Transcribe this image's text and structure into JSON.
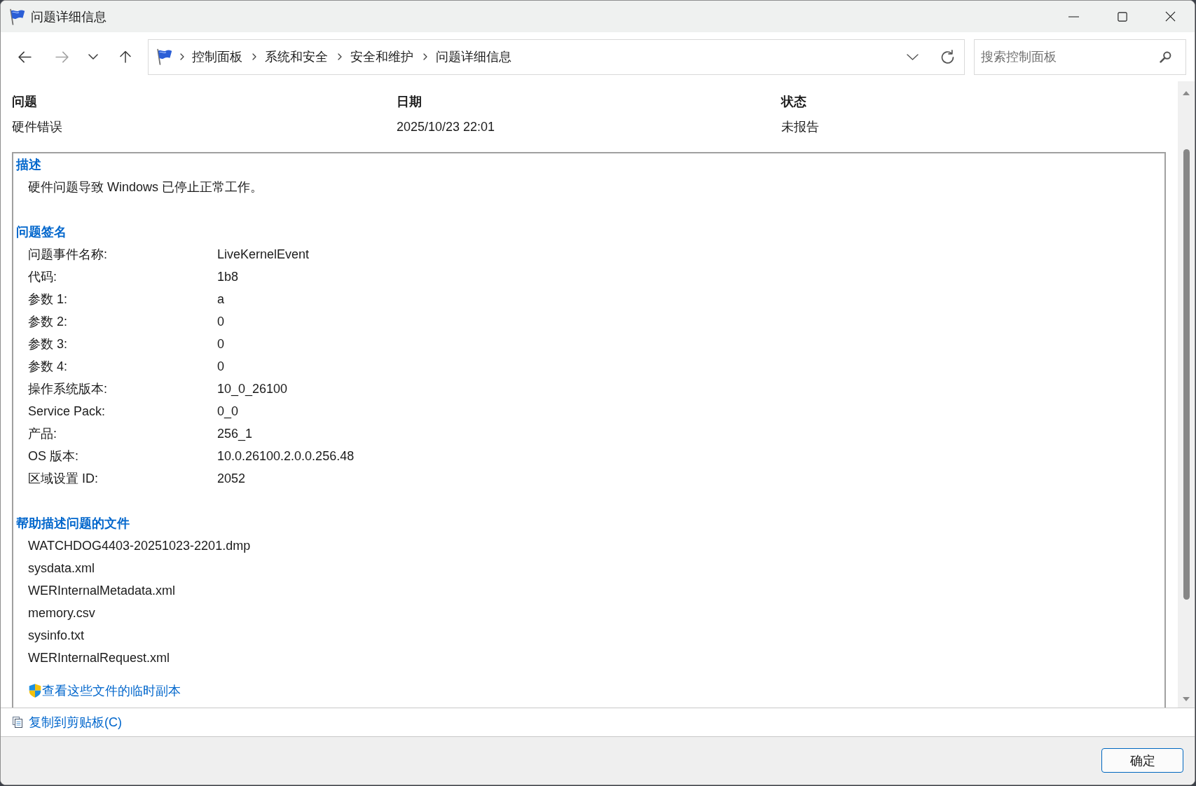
{
  "window": {
    "title": "问题详细信息"
  },
  "navigation": {
    "buttons": [
      {
        "disabled": false
      },
      {
        "disabled": true
      },
      {
        "disabled": false
      },
      {
        "disabled": false
      }
    ],
    "breadcrumbs": [
      "控制面板",
      "系统和安全",
      "安全和维护",
      "问题详细信息"
    ],
    "search": {
      "placeholder": "搜索控制面板"
    }
  },
  "summary": [
    {
      "heading": "问题",
      "value": "硬件错误"
    },
    {
      "heading": "日期",
      "value": "2025/10/23 22:01"
    },
    {
      "heading": "状态",
      "value": "未报告"
    }
  ],
  "details": [
    {
      "kind": "text",
      "heading": "描述",
      "text": "硬件问题导致 Windows 已停止正常工作。"
    },
    {
      "kind": "fields",
      "heading": "问题签名",
      "fields": [
        {
          "label": "问题事件名称:",
          "value": "LiveKernelEvent"
        },
        {
          "label": "代码:",
          "value": "1b8"
        },
        {
          "label": "参数 1:",
          "value": "a"
        },
        {
          "label": "参数 2:",
          "value": "0"
        },
        {
          "label": "参数 3:",
          "value": "0"
        },
        {
          "label": "参数 4:",
          "value": "0"
        },
        {
          "label": "操作系统版本:",
          "value": "10_0_26100"
        },
        {
          "label": "Service Pack:",
          "value": "0_0"
        },
        {
          "label": "产品:",
          "value": "256_1"
        },
        {
          "label": "OS 版本:",
          "value": "10.0.26100.2.0.0.256.48"
        },
        {
          "label": "区域设置 ID:",
          "value": "2052"
        }
      ]
    },
    {
      "kind": "files",
      "heading": "帮助描述问题的文件",
      "files": [
        "WATCHDOG4403-20251023-2201.dmp",
        "sysdata.xml",
        "WERInternalMetadata.xml",
        "memory.csv",
        "sysinfo.txt",
        "WERInternalRequest.xml"
      ],
      "link": "查看这些文件的临时副本"
    }
  ],
  "copy_link": "复制到剪贴板(C)",
  "buttons": [
    "确定"
  ]
}
